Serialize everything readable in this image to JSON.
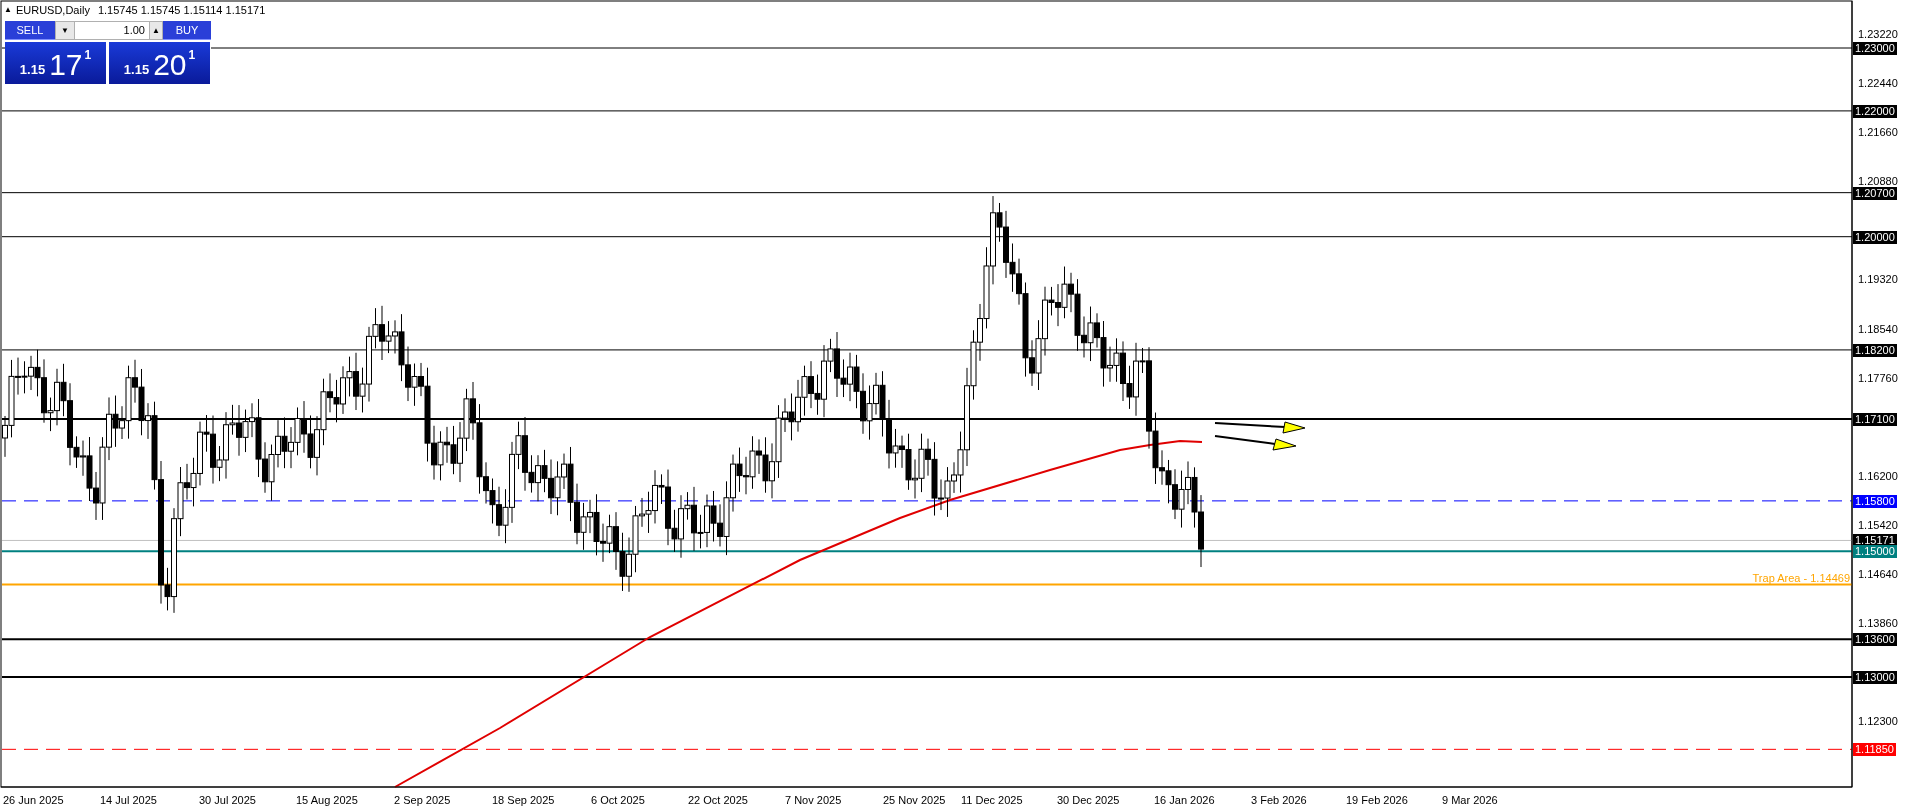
{
  "header": {
    "collapse_glyph": "▲",
    "symbol": "EURUSD,Daily",
    "ohlc": "1.15745 1.15745 1.15114 1.15171"
  },
  "trade_panel": {
    "sell": {
      "label": "SELL",
      "price_prefix": "1.15",
      "price_big": "17",
      "price_super": "1"
    },
    "lot_down": "▼",
    "lot": "1.00",
    "lot_up": "▲",
    "buy": {
      "label": "BUY",
      "price_prefix": "1.15",
      "price_big": "20",
      "price_super": "1"
    }
  },
  "chart": {
    "levels": [
      {
        "label": "1.23000",
        "kind": "solid",
        "color": "#000000"
      },
      {
        "label": "1.22000",
        "kind": "solid",
        "color": "#000000"
      },
      {
        "label": "1.20700",
        "kind": "solid",
        "color": "#000000"
      },
      {
        "label": "1.20000",
        "kind": "solid",
        "color": "#000000"
      },
      {
        "label": "1.18200",
        "kind": "solid",
        "color": "#000000"
      },
      {
        "label": "1.17100",
        "kind": "thick",
        "color": "#000000"
      },
      {
        "label": "1.15800",
        "kind": "dashed",
        "color": "#0000ff"
      },
      {
        "label": "1.15171",
        "kind": "current",
        "color": "#000000"
      },
      {
        "label": "1.15000",
        "kind": "thick",
        "color": "#008080"
      },
      {
        "note": "Trap Area - 1.14469",
        "kind": "thick",
        "color": "#ffa500"
      },
      {
        "label": "1.13600",
        "kind": "thick",
        "color": "#000000"
      },
      {
        "label": "1.13000",
        "kind": "thick",
        "color": "#000000"
      },
      {
        "label": "1.11850",
        "kind": "dashed",
        "color": "#ff0000"
      }
    ],
    "price_ticks": [
      "1.23220",
      "1.22440",
      "1.21660",
      "1.20880",
      "1.19320",
      "1.18540",
      "1.17760",
      "1.16200",
      "1.15420",
      "1.14640",
      "1.13860",
      "1.12300"
    ],
    "dates": [
      "26 Jun 2025",
      "14 Jul 2025",
      "30 Jul 2025",
      "15 Aug 2025",
      "2 Sep 2025",
      "18 Sep 2025",
      "6 Oct 2025",
      "22 Oct 2025",
      "7 Nov 2025",
      "25 Nov 2025",
      "11 Dec 2025",
      "30 Dec 2025",
      "16 Jan 2026",
      "3 Feb 2026",
      "19 Feb 2026",
      "9 Mar 2026"
    ]
  }
}
